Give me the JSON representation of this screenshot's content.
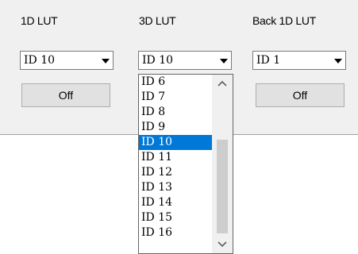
{
  "columns": [
    {
      "label": "1D LUT",
      "value": "ID 10",
      "button": "Off"
    },
    {
      "label": "3D LUT",
      "value": "ID 10"
    },
    {
      "label": "Back 1D LUT",
      "value": "ID 1",
      "button": "Off"
    }
  ],
  "dropdown": {
    "items": [
      "ID 6",
      "ID 7",
      "ID 8",
      "ID 9",
      "ID 10",
      "ID 11",
      "ID 12",
      "ID 13",
      "ID 14",
      "ID 15",
      "ID 16"
    ],
    "selected": "ID 10",
    "scroll_up_icon": "chevron-up-icon",
    "scroll_down_icon": "chevron-down-icon"
  },
  "colors": {
    "selection": "#0078d7",
    "panel": "#f0f0f0"
  }
}
